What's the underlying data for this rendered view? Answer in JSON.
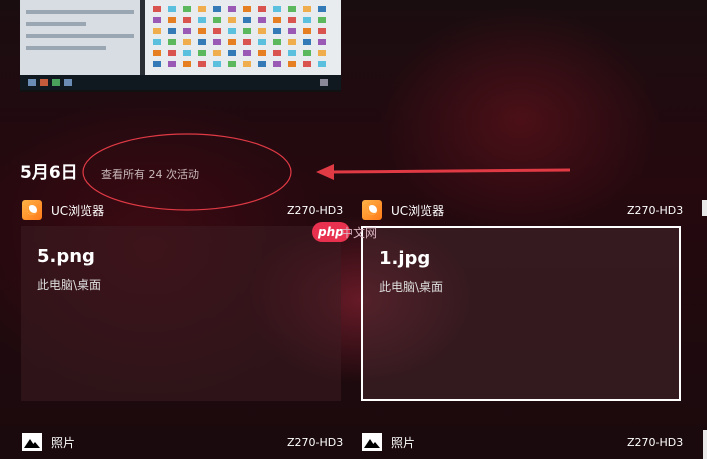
{
  "date_header": "5月6日",
  "view_all_label": "查看所有 24 次活动",
  "watermark": {
    "badge": "php",
    "text": "中文网"
  },
  "icons": {
    "uc_browser": "uc-browser-icon",
    "photos": "photos-icon",
    "arrow": "red-arrow-annotation"
  },
  "colors": {
    "annotation_red": "#e03a45",
    "selected_border": "#ffffff"
  },
  "activities": [
    {
      "app": "UC浏览器",
      "device": "Z270-HD3",
      "title": "5.png",
      "path": "此电脑\\桌面",
      "selected": false
    },
    {
      "app": "UC浏览器",
      "device": "Z270-HD3",
      "title": "1.jpg",
      "path": "此电脑\\桌面",
      "selected": true
    }
  ],
  "bottom_rows": [
    {
      "app": "照片",
      "device": "Z270-HD3"
    },
    {
      "app": "照片",
      "device": "Z270-HD3"
    }
  ]
}
